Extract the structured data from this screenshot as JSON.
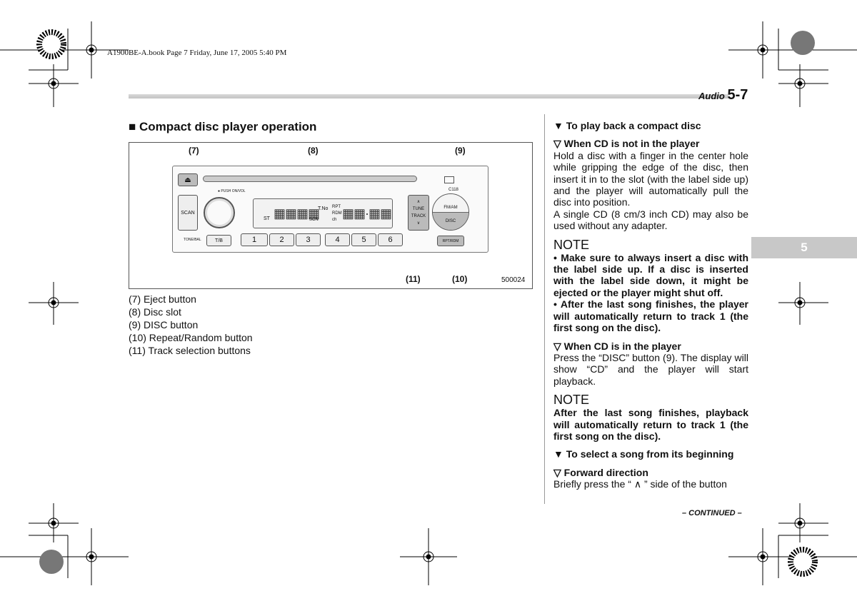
{
  "header": {
    "book_line": "A1900BE-A.book  Page 7  Friday, June 17, 2005  5:40 PM",
    "section": "Audio",
    "page": "5-7",
    "chapter_tab": "5"
  },
  "left": {
    "title": "■ Compact disc player operation",
    "figure": {
      "callouts": [
        "(7)",
        "(8)",
        "(9)",
        "(10)",
        "(11)"
      ],
      "figure_id": "500024",
      "radio_labels": {
        "push": "● PUSH ON/VOL",
        "scan": "SCAN",
        "tone": "TONE/BAL",
        "tb": "T/B",
        "presets": [
          "1",
          "2",
          "3",
          "4",
          "5",
          "6"
        ],
        "tune": "TUNE",
        "track": "TRACK",
        "fmam": "FM/AM",
        "disc": "DISC",
        "rptrdm": "RPT/RDM",
        "model": "C118",
        "display_left": "ST",
        "display_tno": "T.No",
        "display_scn": "SCN",
        "display_rpt": "RPT",
        "display_rdm": "RDM",
        "display_ch": "ch"
      }
    },
    "captions": [
      "(7)  Eject button",
      "(8)  Disc slot",
      "(9)  DISC button",
      "(10) Repeat/Random button",
      "(11) Track selection buttons"
    ]
  },
  "right": {
    "h_play": "▼ To play back a compact disc",
    "h_not_in": "▽ When CD is not in the player",
    "p1": "Hold a disc with a finger in the center hole while gripping the edge of the disc, then insert it in to the slot (with the label side up) and the player will automatically pull the disc into position.",
    "p2": "A single CD (8 cm/3 inch CD) may also be used without any adapter.",
    "note1": "NOTE",
    "n1a": "• Make sure to always insert a disc with the label side up. If a disc is inserted with the label side down, it might be ejected or the player might shut off.",
    "n1b": "• After the last song finishes, the player will automatically return to track 1 (the first song on the disc).",
    "h_in": "▽ When CD is in the player",
    "p3": "Press the “DISC” button (9). The display will show “CD” and the player will start playback.",
    "note2": "NOTE",
    "n2": "After the last song finishes, playback will automatically return to track 1 (the first song on the disc).",
    "h_select": "▼ To select a song from its beginning",
    "h_fwd": "▽ Forward direction",
    "p4": "Briefly press the “ ∧ ” side of the button"
  },
  "footer": {
    "continued": "– CONTINUED –"
  }
}
